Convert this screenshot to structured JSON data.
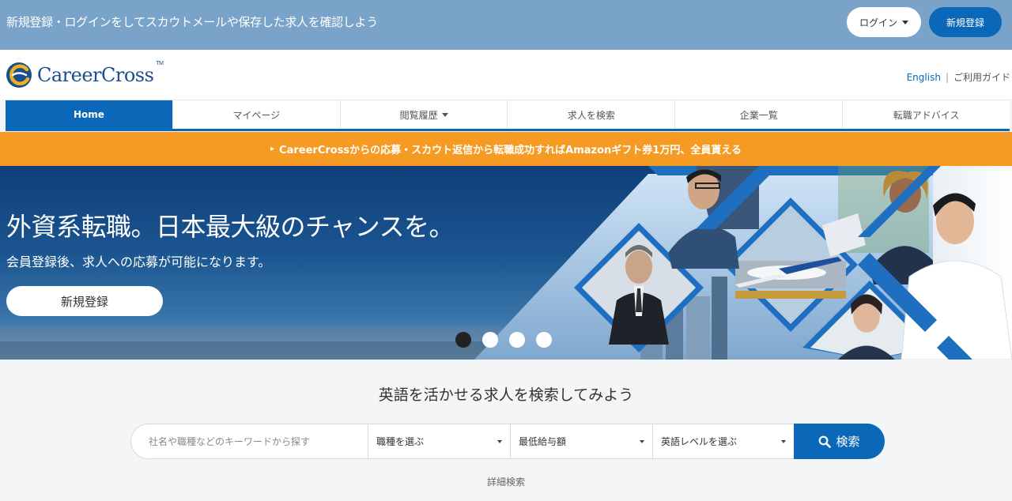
{
  "topbar": {
    "message": "新規登録・ログインをしてスカウトメールや保存した求人を確認しよう",
    "login_label": "ログイン",
    "register_label": "新規登録"
  },
  "header": {
    "logo_text": "CareerCross",
    "logo_tm": "TM",
    "english_link": "English",
    "separator": "|",
    "guide_link": "ご利用ガイド"
  },
  "nav": {
    "items": [
      {
        "label": "Home",
        "active": true
      },
      {
        "label": "マイページ"
      },
      {
        "label": "閲覧履歴",
        "has_dropdown": true
      },
      {
        "label": "求人を検索"
      },
      {
        "label": "企業一覧"
      },
      {
        "label": "転職アドバイス"
      }
    ]
  },
  "promo": {
    "chevron": "▸",
    "text": "CareerCrossからの応募・スカウト返信から転職成功すればAmazonギフト券1万円、全員貰える"
  },
  "hero": {
    "title": "外資系転職。日本最大級のチャンスを。",
    "subtitle": "会員登録後、求人への応募が可能になります。",
    "button_label": "新規登録",
    "slides_total": 4,
    "active_slide": 1
  },
  "search": {
    "title": "英語を活かせる求人を検索してみよう",
    "keyword_placeholder": "社名や職種などのキーワードから探す",
    "job_type_select": "職種を選ぶ",
    "salary_select": "最低給与額",
    "english_level_select": "英語レベルを選ぶ",
    "search_button": "検索",
    "advanced_link": "詳細検索"
  },
  "colors": {
    "topbar": "#79a3c8",
    "brand_blue": "#0b68b8",
    "promo_orange": "#f59b23",
    "page_bg": "#f3f5f7"
  }
}
